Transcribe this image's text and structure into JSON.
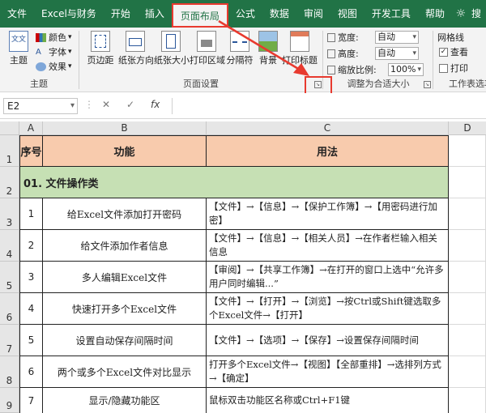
{
  "tabs": [
    {
      "id": "file",
      "label": "文件"
    },
    {
      "id": "excel-finance",
      "label": "Excel与财务"
    },
    {
      "id": "home",
      "label": "开始"
    },
    {
      "id": "insert",
      "label": "插入"
    },
    {
      "id": "page-layout",
      "label": "页面布局",
      "active": true
    },
    {
      "id": "formulas",
      "label": "公式"
    },
    {
      "id": "data",
      "label": "数据"
    },
    {
      "id": "review",
      "label": "审阅"
    },
    {
      "id": "view",
      "label": "视图"
    },
    {
      "id": "developer",
      "label": "开发工具"
    },
    {
      "id": "help",
      "label": "帮助"
    }
  ],
  "tab_extra": "搜",
  "ribbon": {
    "theme_group": {
      "label": "主题",
      "theme_button": "主题",
      "colors": "颜色",
      "fonts": "字体",
      "effects": "效果"
    },
    "page_setup_group": {
      "label": "页面设置",
      "buttons": [
        "页边距",
        "纸张方向",
        "纸张大小",
        "打印区域",
        "分隔符",
        "背景",
        "打印标题"
      ]
    },
    "scale_group": {
      "label": "调整为合适大小",
      "width_label": "宽度:",
      "width_value": "自动",
      "height_label": "高度:",
      "height_value": "自动",
      "scale_label": "缩放比例:",
      "scale_value": "100%"
    },
    "sheet_options_group": {
      "label": "工作表选项",
      "gridlines": "网格线",
      "view": "查看",
      "print": "打印"
    }
  },
  "formula_bar": {
    "name_box": "E2",
    "cancel": "✕",
    "enter": "✓",
    "fx": "fx",
    "value": ""
  },
  "columns": [
    "A",
    "B",
    "C",
    "D"
  ],
  "rows": [
    "1",
    "2",
    "3",
    "4",
    "5",
    "6",
    "7",
    "8",
    "9"
  ],
  "table": {
    "headers": {
      "seq": "序号",
      "function": "功能",
      "usage": "用法"
    },
    "category": "01. 文件操作类",
    "items": [
      {
        "seq": "1",
        "function": "给Excel文件添加打开密码",
        "usage": "【文件】→【信息】→【保护工作簿】→【用密码进行加密】"
      },
      {
        "seq": "2",
        "function": "给文件添加作者信息",
        "usage": "【文件】→【信息】→【相关人员】→在作者栏输入相关信息"
      },
      {
        "seq": "3",
        "function": "多人编辑Excel文件",
        "usage": "【审阅】→【共享工作簿】→在打开的窗口上选中“允许多用户同时编辑...”"
      },
      {
        "seq": "4",
        "function": "快速打开多个Excel文件",
        "usage": "【文件】→【打开】→【浏览】→按Ctrl或Shift键选取多个Excel文件→【打开】"
      },
      {
        "seq": "5",
        "function": "设置自动保存间隔时间",
        "usage": "【文件】→【选项】→【保存】→设置保存间隔时间"
      },
      {
        "seq": "6",
        "function": "两个或多个Excel文件对比显示",
        "usage": "打开多个Excel文件→【视图】【全部重排】→选排列方式→【确定】"
      },
      {
        "seq": "7",
        "function": "显示/隐藏功能区",
        "usage": "鼠标双击功能区名称或Ctrl+F1键"
      }
    ]
  },
  "colors": {
    "ribbon_green": "#217346",
    "header_fill": "#f8cbad",
    "category_fill": "#c6e0b4",
    "highlight_red": "#e83a2f"
  }
}
